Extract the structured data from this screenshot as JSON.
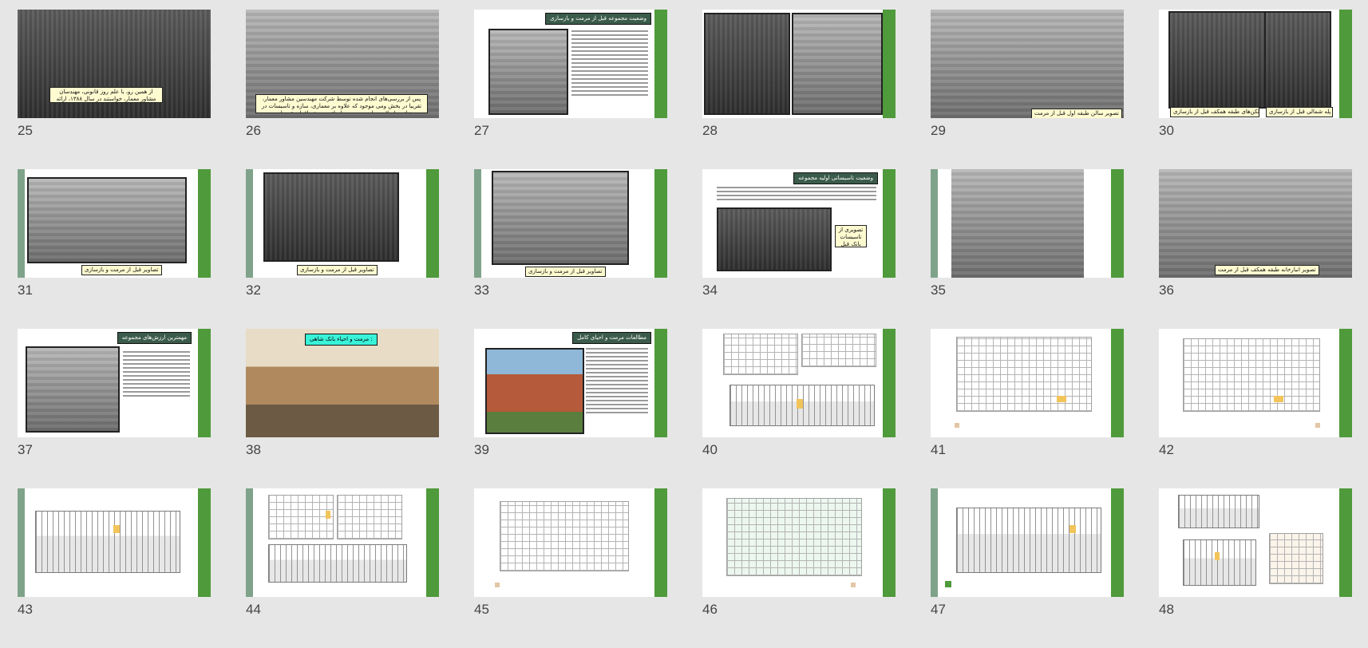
{
  "slides": [
    {
      "number": "25",
      "captions": [
        "از همین رو، با علم روز قانونی، مهندسان مشاور معمار، خواستند در سال ۱۳۸۸، ارائه طرح مرمت جامع مجموعه را بر عهده گرفت."
      ]
    },
    {
      "number": "26",
      "captions": [
        "پس از بررسی‌های انجام شده توسط شرکت مهندسین مشاور معمار، تقریبا در بخش ومی موجود که علاوه بر معماری، سازه و تاسیسات در نیاز به اصلاح و طرح مرمت و احیاء مجموعه اقدام شده است."
      ]
    },
    {
      "number": "27",
      "title": "وضعیت مجموعه قبل از مرمت و بازسازی"
    },
    {
      "number": "28"
    },
    {
      "number": "29",
      "captions": [
        "تصویر سالن طبقه اول قبل از مرمت"
      ]
    },
    {
      "number": "30",
      "captions": [
        "دید به بالکن‌های طبقه همکف قبل از بازسازی",
        "دید به راه پله شمالی قبل از بازسازی"
      ]
    },
    {
      "number": "31",
      "captions": [
        "تصاویر قبل از مرمت و بازسازی"
      ]
    },
    {
      "number": "32",
      "captions": [
        "تصاویر قبل از مرمت و بازسازی"
      ]
    },
    {
      "number": "33",
      "captions": [
        "تصاویر قبل از مرمت و بازسازی"
      ]
    },
    {
      "number": "34",
      "title": "وضعیت تاسیساتی اولیه مجموعه",
      "captions": [
        "تصویری از تاسیسات بانک قبل از مرمت"
      ]
    },
    {
      "number": "35"
    },
    {
      "number": "36",
      "captions": [
        "تصویر انبارخانه طبقه همکف قبل از مرمت"
      ]
    },
    {
      "number": "37",
      "title": "مهمترین ارزش‌های مجموعه"
    },
    {
      "number": "38",
      "title": "مرمت و احیاء بانک شاهی :"
    },
    {
      "number": "39",
      "title": "مطالعات مرمت و احیای کامل"
    },
    {
      "number": "40"
    },
    {
      "number": "41"
    },
    {
      "number": "42"
    },
    {
      "number": "43"
    },
    {
      "number": "44"
    },
    {
      "number": "45"
    },
    {
      "number": "46"
    },
    {
      "number": "47"
    },
    {
      "number": "48"
    }
  ],
  "colors": {
    "background": "#e6e6e6",
    "accent_green": "#4f9a3b",
    "side_gray_green": "#7fa38a",
    "title_dark": "#3b5b4b",
    "caption_bg": "#fffbd0"
  }
}
